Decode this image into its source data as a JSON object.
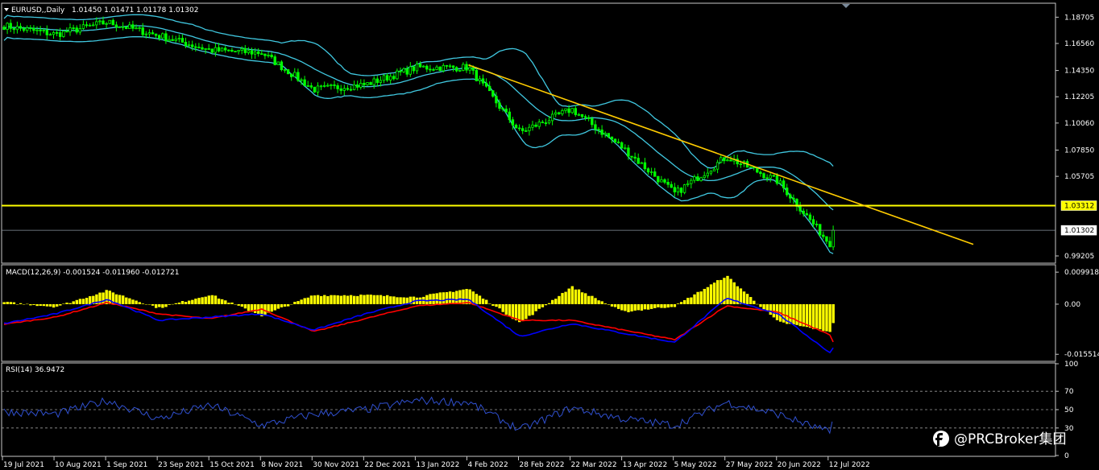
{
  "watermark": "@PRCBroker集团",
  "main_header": {
    "symbol": "EURUSD,,Daily",
    "ohlc": "1.01450 1.01471 1.01178 1.01302"
  },
  "macd_header": "MACD(12,26,9) -0.001524 -0.011960 -0.012721",
  "rsi_header": "RSI(14) 36.9472",
  "chart_data": [
    {
      "type": "candlestick",
      "title": "EURUSD,,Daily",
      "overlays": [
        "Bollinger Bands"
      ],
      "ylim": [
        0.9868,
        1.1978
      ],
      "yticks": [
        "1.18705",
        "1.16560",
        "1.14350",
        "1.12205",
        "1.10060",
        "1.07850",
        "1.05705",
        "0.99205"
      ],
      "price_labels": [
        {
          "label": "1.03312",
          "value": 1.03312,
          "color": "#ffff00"
        },
        {
          "label": "1.01302",
          "value": 1.01302,
          "color": "#ffffff"
        }
      ],
      "horizontal_line": 1.03312,
      "trendline": {
        "from": {
          "date": "4 Feb 2022",
          "value": 1.148
        },
        "to": {
          "date": "14 Jul 2022",
          "value": 1.0418
        }
      },
      "x_dates": [
        "19 Jul 2021",
        "10 Aug 2021",
        "1 Sep 2021",
        "23 Sep 2021",
        "15 Oct 2021",
        "8 Nov 2021",
        "30 Nov 2021",
        "22 Dec 2021",
        "13 Jan 2022",
        "4 Feb 2022",
        "28 Feb 2022",
        "22 Mar 2022",
        "13 Apr 2022",
        "5 May 2022",
        "27 May 2022",
        "20 Jun 2022",
        "12 Jul 2022"
      ],
      "close_anchors": [
        {
          "date": "19 Jul 2021",
          "value": 1.18
        },
        {
          "date": "10 Aug 2021",
          "value": 1.173
        },
        {
          "date": "1 Sep 2021",
          "value": 1.183
        },
        {
          "date": "23 Sep 2021",
          "value": 1.172
        },
        {
          "date": "15 Oct 2021",
          "value": 1.16
        },
        {
          "date": "8 Nov 2021",
          "value": 1.158
        },
        {
          "date": "30 Nov 2021",
          "value": 1.128
        },
        {
          "date": "22 Dec 2021",
          "value": 1.132
        },
        {
          "date": "13 Jan 2022",
          "value": 1.146
        },
        {
          "date": "4 Feb 2022",
          "value": 1.146
        },
        {
          "date": "28 Feb 2022",
          "value": 1.093
        },
        {
          "date": "22 Mar 2022",
          "value": 1.112
        },
        {
          "date": "13 Apr 2022",
          "value": 1.08
        },
        {
          "date": "5 May 2022",
          "value": 1.043
        },
        {
          "date": "27 May 2022",
          "value": 1.073
        },
        {
          "date": "20 Jun 2022",
          "value": 1.053
        },
        {
          "date": "12 Jul 2022",
          "value": 1.002
        },
        {
          "date": "14 Jul 2022",
          "value": 1.01302
        }
      ]
    },
    {
      "type": "macd",
      "title": "MACD(12,26,9) -0.001524 -0.011960 -0.012721",
      "params": [
        12,
        26,
        9
      ],
      "ylim": [
        -0.0172,
        0.0112
      ],
      "yticks": [
        "0.009918",
        "0.00",
        "-0.015514"
      ],
      "histogram_color": "#ffff00",
      "macd_color": "#0000ff",
      "signal_color": "#ff0000",
      "histogram_anchors": [
        {
          "date": "19 Jul 2021",
          "value": 0.0006
        },
        {
          "date": "10 Aug 2021",
          "value": -0.0008
        },
        {
          "date": "1 Sep 2021",
          "value": 0.0042
        },
        {
          "date": "23 Sep 2021",
          "value": -0.0012
        },
        {
          "date": "15 Oct 2021",
          "value": 0.003
        },
        {
          "date": "8 Nov 2021",
          "value": -0.0036
        },
        {
          "date": "30 Nov 2021",
          "value": 0.0028
        },
        {
          "date": "22 Dec 2021",
          "value": 0.0028
        },
        {
          "date": "13 Jan 2022",
          "value": 0.0022
        },
        {
          "date": "4 Feb 2022",
          "value": 0.0048
        },
        {
          "date": "28 Feb 2022",
          "value": -0.0058
        },
        {
          "date": "22 Mar 2022",
          "value": 0.0054
        },
        {
          "date": "13 Apr 2022",
          "value": -0.0024
        },
        {
          "date": "5 May 2022",
          "value": -0.0006
        },
        {
          "date": "27 May 2022",
          "value": 0.0088
        },
        {
          "date": "20 Jun 2022",
          "value": -0.0055
        },
        {
          "date": "12 Jul 2022",
          "value": -0.0085
        },
        {
          "date": "14 Jul 2022",
          "value": -0.0052
        }
      ],
      "macd_anchors": [
        {
          "date": "19 Jul 2021",
          "value": -0.006
        },
        {
          "date": "10 Aug 2021",
          "value": -0.003
        },
        {
          "date": "1 Sep 2021",
          "value": 0.0015
        },
        {
          "date": "23 Sep 2021",
          "value": -0.005
        },
        {
          "date": "15 Oct 2021",
          "value": -0.004
        },
        {
          "date": "8 Nov 2021",
          "value": -0.003
        },
        {
          "date": "30 Nov 2021",
          "value": -0.008
        },
        {
          "date": "22 Dec 2021",
          "value": -0.003
        },
        {
          "date": "13 Jan 2022",
          "value": 0.001
        },
        {
          "date": "4 Feb 2022",
          "value": 0.0015
        },
        {
          "date": "28 Feb 2022",
          "value": -0.01
        },
        {
          "date": "22 Mar 2022",
          "value": -0.006
        },
        {
          "date": "13 Apr 2022",
          "value": -0.009
        },
        {
          "date": "5 May 2022",
          "value": -0.0118
        },
        {
          "date": "27 May 2022",
          "value": 0.0018
        },
        {
          "date": "20 Jun 2022",
          "value": -0.003
        },
        {
          "date": "12 Jul 2022",
          "value": -0.015
        },
        {
          "date": "14 Jul 2022",
          "value": -0.013
        }
      ],
      "signal_anchors": [
        {
          "date": "19 Jul 2021",
          "value": -0.0062
        },
        {
          "date": "10 Aug 2021",
          "value": -0.004
        },
        {
          "date": "1 Sep 2021",
          "value": 0.0005
        },
        {
          "date": "23 Sep 2021",
          "value": -0.003
        },
        {
          "date": "15 Oct 2021",
          "value": -0.0045
        },
        {
          "date": "8 Nov 2021",
          "value": -0.0015
        },
        {
          "date": "30 Nov 2021",
          "value": -0.0085
        },
        {
          "date": "22 Dec 2021",
          "value": -0.0045
        },
        {
          "date": "13 Jan 2022",
          "value": -0.0005
        },
        {
          "date": "4 Feb 2022",
          "value": 0.0005
        },
        {
          "date": "28 Feb 2022",
          "value": -0.005
        },
        {
          "date": "22 Mar 2022",
          "value": -0.005
        },
        {
          "date": "13 Apr 2022",
          "value": -0.008
        },
        {
          "date": "5 May 2022",
          "value": -0.011
        },
        {
          "date": "27 May 2022",
          "value": -0.0005
        },
        {
          "date": "20 Jun 2022",
          "value": -0.0025
        },
        {
          "date": "12 Jul 2022",
          "value": -0.0095
        },
        {
          "date": "14 Jul 2022",
          "value": -0.0125
        }
      ]
    },
    {
      "type": "line",
      "title": "RSI(14) 36.9472",
      "ylim": [
        0,
        100
      ],
      "yticks": [
        "100",
        "70",
        "50",
        "30",
        "0"
      ],
      "levels": [
        70,
        50,
        30
      ],
      "line_color": "#3050d0",
      "anchors": [
        {
          "date": "19 Jul 2021",
          "value": 48
        },
        {
          "date": "10 Aug 2021",
          "value": 45
        },
        {
          "date": "1 Sep 2021",
          "value": 60
        },
        {
          "date": "23 Sep 2021",
          "value": 40
        },
        {
          "date": "15 Oct 2021",
          "value": 55
        },
        {
          "date": "8 Nov 2021",
          "value": 33
        },
        {
          "date": "30 Nov 2021",
          "value": 45
        },
        {
          "date": "22 Dec 2021",
          "value": 50
        },
        {
          "date": "13 Jan 2022",
          "value": 60
        },
        {
          "date": "4 Feb 2022",
          "value": 58
        },
        {
          "date": "28 Feb 2022",
          "value": 28
        },
        {
          "date": "22 Mar 2022",
          "value": 52
        },
        {
          "date": "13 Apr 2022",
          "value": 40
        },
        {
          "date": "5 May 2022",
          "value": 33
        },
        {
          "date": "27 May 2022",
          "value": 58
        },
        {
          "date": "20 Jun 2022",
          "value": 45
        },
        {
          "date": "12 Jul 2022",
          "value": 25
        },
        {
          "date": "14 Jul 2022",
          "value": 36.9472
        }
      ]
    }
  ]
}
